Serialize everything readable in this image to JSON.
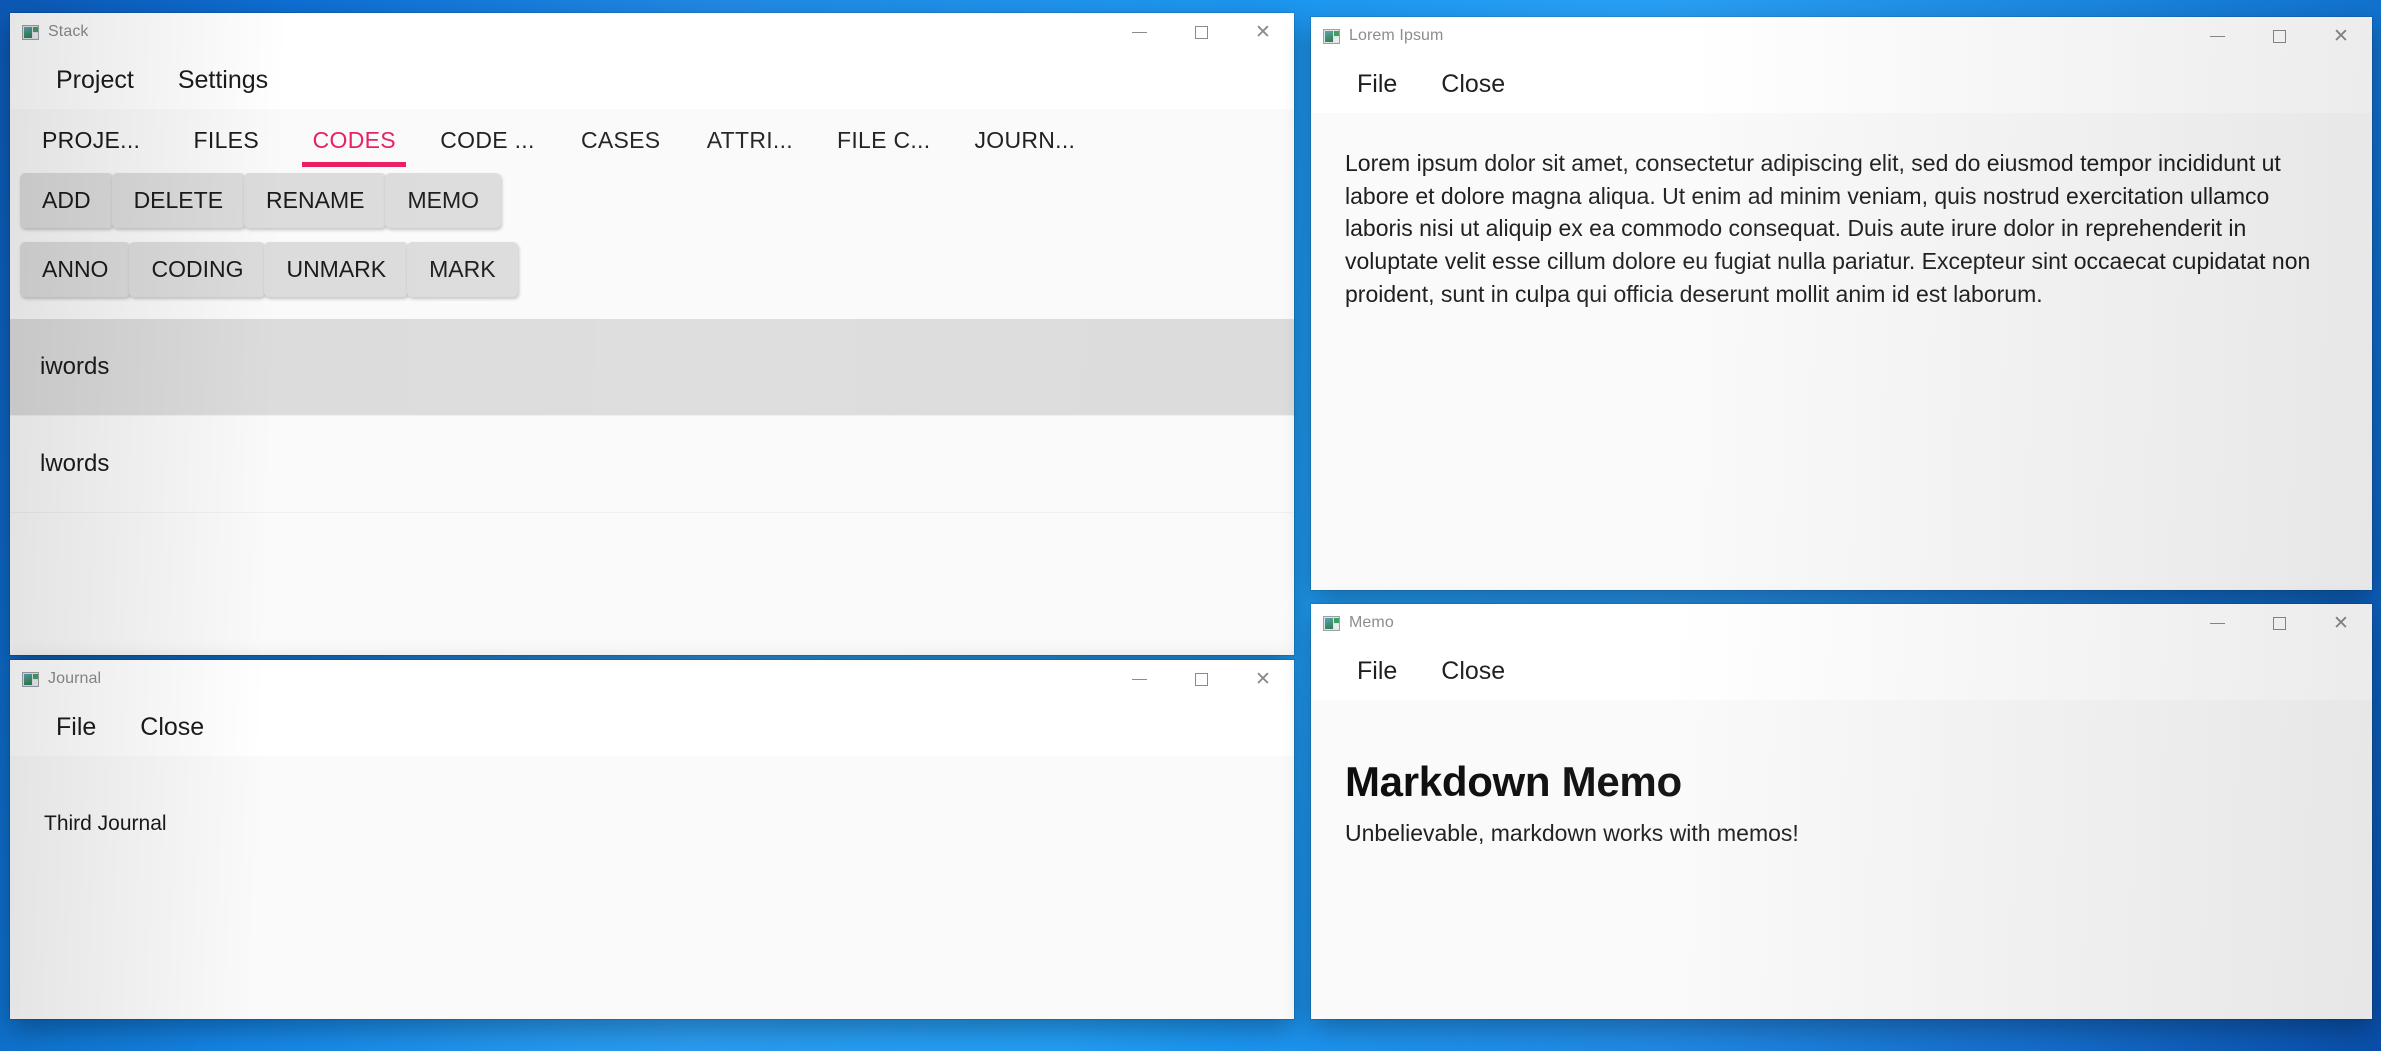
{
  "desktop": {
    "background_color": "#1688e8"
  },
  "accent": {
    "active_tab_color": "#e91e63"
  },
  "windows": {
    "stack": {
      "title": "Stack",
      "icon": "app-window-icon",
      "controls": {
        "minimize": "—",
        "maximize": "□",
        "close": "✕"
      },
      "menu": [
        {
          "label": "Project"
        },
        {
          "label": "Settings"
        }
      ],
      "tabs": [
        {
          "label": "PROJE...",
          "active": false
        },
        {
          "label": "FILES",
          "active": false
        },
        {
          "label": "CODES",
          "active": true
        },
        {
          "label": "CODE ...",
          "active": false
        },
        {
          "label": "CASES",
          "active": false
        },
        {
          "label": "ATTRI...",
          "active": false
        },
        {
          "label": "FILE C...",
          "active": false
        },
        {
          "label": "JOURN...",
          "active": false
        }
      ],
      "button_rows": [
        [
          {
            "label": "ADD"
          },
          {
            "label": "DELETE"
          },
          {
            "label": "RENAME"
          },
          {
            "label": "MEMO"
          }
        ],
        [
          {
            "label": "ANNO"
          },
          {
            "label": "CODING"
          },
          {
            "label": "UNMARK"
          },
          {
            "label": "MARK"
          }
        ]
      ],
      "list": [
        {
          "label": "iwords",
          "selected": true
        },
        {
          "label": "lwords",
          "selected": false
        }
      ]
    },
    "lorem": {
      "title": "Lorem Ipsum",
      "icon": "app-window-icon",
      "controls": {
        "minimize": "—",
        "maximize": "□",
        "close": "✕"
      },
      "menu": [
        {
          "label": "File"
        },
        {
          "label": "Close"
        }
      ],
      "body_text": "Lorem ipsum dolor sit amet, consectetur adipiscing elit, sed do eiusmod tempor incididunt ut labore et dolore magna aliqua. Ut enim ad minim veniam, quis nostrud exercitation ullamco laboris nisi ut aliquip ex ea commodo consequat. Duis aute irure dolor in reprehenderit in voluptate velit esse cillum dolore eu fugiat nulla pariatur. Excepteur sint occaecat cupidatat non proident, sunt in culpa qui officia deserunt mollit anim id est laborum."
    },
    "journal": {
      "title": "Journal",
      "icon": "app-window-icon",
      "controls": {
        "minimize": "—",
        "maximize": "□",
        "close": "✕"
      },
      "menu": [
        {
          "label": "File"
        },
        {
          "label": "Close"
        }
      ],
      "body_text": "Third Journal"
    },
    "memo": {
      "title": "Memo",
      "icon": "app-window-icon",
      "controls": {
        "minimize": "—",
        "maximize": "□",
        "close": "✕"
      },
      "menu": [
        {
          "label": "File"
        },
        {
          "label": "Close"
        }
      ],
      "heading": "Markdown Memo",
      "body_text": "Unbelievable, markdown works with memos!"
    }
  }
}
